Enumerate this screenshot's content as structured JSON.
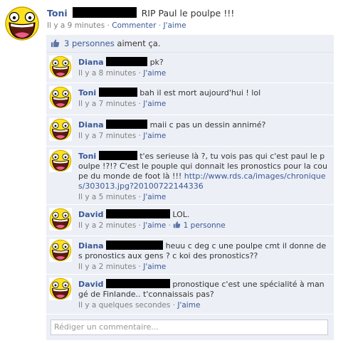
{
  "post": {
    "author": "Toni",
    "text": "RIP Paul le poulpe !!!",
    "time": "Il y a 9 minutes",
    "comment_label": "Commenter",
    "like_label": "J'aime",
    "separator": "·"
  },
  "likes": {
    "count_label": "3 personnes",
    "suffix": "aiment ça."
  },
  "comments": [
    {
      "author": "Diana",
      "text": "pk?",
      "time": "Il y a 8 minutes",
      "like_label": "J'aime",
      "redact_w": 58
    },
    {
      "author": "Toni",
      "text": "bah il est mort aujourd'hui ! lol",
      "time": "Il y a 7 minutes",
      "like_label": "J'aime",
      "redact_w": 54
    },
    {
      "author": "Diana",
      "text": "maii c pas un dessin annimé?",
      "time": "Il y a 7 minutes",
      "like_label": "J'aime",
      "redact_w": 58
    },
    {
      "author": "Toni",
      "text": "t'es serieuse là ?, tu vois pas qui c'est paul le poulpe !?!? C'est le pouple qui donnait les pronostics pour la coupe du monde de foot là !!!",
      "link": "http://www.rds.ca/images/chroniques/303013.jpg?20100722144336",
      "time": "Il y a 5 minutes",
      "like_label": "J'aime",
      "redact_w": 54
    },
    {
      "author": "David",
      "text": "LOL.",
      "time": "Il y a 2 minutes",
      "like_label": "J'aime",
      "like_count": "1 personne",
      "redact_w": 90
    },
    {
      "author": "Diana",
      "text": "heuu c deg c une poulpe cmt il donne des pronostics aux gens ? c koi des pronostics??",
      "time": "Il y a 2 minutes",
      "like_label": "J'aime",
      "redact_w": 80
    },
    {
      "author": "David",
      "text": "pronostique c'est une spécialité à mangé de Finlande.. t'connaissais pas?",
      "time": "Il y a quelques secondes",
      "like_label": "J'aime",
      "redact_w": 90
    }
  ],
  "reply": {
    "placeholder": "Rédiger un commentaire..."
  },
  "colors": {
    "link": "#3b5998",
    "comment_bg": "#eceff5",
    "meta": "#808080"
  },
  "icons": {
    "avatar": "awesome-smiley-face",
    "like": "thumbs-up-icon"
  }
}
